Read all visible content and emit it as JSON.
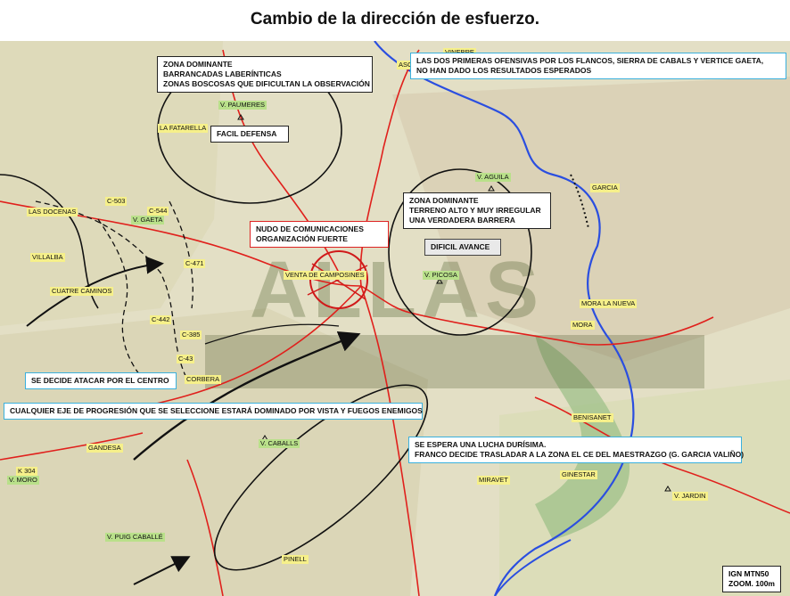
{
  "title": "Cambio de la dirección de esfuerzo.",
  "annotations": {
    "zona_dominante_1": [
      "ZONA DOMINANTE",
      "BARRANCADAS LABERÍNTICAS",
      "ZONAS BOSCOSAS QUE DIFICULTAN LA OBSERVACIÓN"
    ],
    "facil_defensa": "FACIL DEFENSA",
    "flancos": [
      "LAS DOS PRIMERAS OFENSIVAS POR LOS FLANCOS, SIERRA DE CABALS Y VERTICE GAETA,",
      "NO HAN DADO LOS RESULTADOS ESPERADOS"
    ],
    "zona_dominante_2": [
      "ZONA DOMINANTE",
      "TERRENO ALTO Y MUY IRREGULAR",
      "UNA VERDADERA BARRERA"
    ],
    "dificil_avance": "DIFICIL AVANCE",
    "nudo": [
      "NUDO DE COMUNICACIONES",
      "ORGANIZACIÓN FUERTE"
    ],
    "atacar_centro": "SE DECIDE ATACAR POR EL CENTRO",
    "eje_progresion": "CUALQUIER EJE DE PROGRESIÓN QUE SE SELECCIONE ESTARÁ DOMINADO POR VISTA Y FUEGOS ENEMIGOS",
    "lucha": [
      "SE ESPERA UNA LUCHA DURÍSIMA.",
      "FRANCO DECIDE  TRASLADAR A LA ZONA EL CE DEL MAESTRAZGO (G. GARCIA VALIÑO)"
    ]
  },
  "places": {
    "paumeres": "V. PAUMERES",
    "fatarella": "LA FATARELLA",
    "aguila": "V. AGUILA",
    "picosa": "V. PICOSA",
    "garcia": "GARCIA",
    "mora_nueva": "MORA LA NUEVA",
    "mora": "MORA",
    "benisanet": "BENISANET",
    "ginestar": "GINESTAR",
    "miravet": "MIRAVET",
    "jardin": "V. JARDIN",
    "gandesa": "GANDESA",
    "k304": "K 304",
    "moro": "V. MORO",
    "puig_caballe": "V. PUIG CABALLÉ",
    "caballs": "V. CABALLS",
    "villalba": "VILLALBA",
    "cuatre_camins": "CUATRE CAMINOS",
    "venta_campo": "VENTA DE CAMPOSINES",
    "corbera": "CORBERA",
    "docenas": "LAS DOCENAS",
    "gaeta": "V. GAETA",
    "ascó": "ASCÓ",
    "vinebre": "VINEBRE",
    "pinell": "PINELL",
    "c503": "C-503",
    "c544": "C-544",
    "c471": "C-471",
    "c385": "C-385",
    "c43": "C-43",
    "c442": "C-442"
  },
  "watermark": "ALLAS",
  "reference": [
    "IGN MTN50",
    "ZOOM. 100m"
  ],
  "colors": {
    "road": "#e0201c",
    "river": "#2a4ee0",
    "front": "#111111",
    "arrow": "#111111"
  }
}
